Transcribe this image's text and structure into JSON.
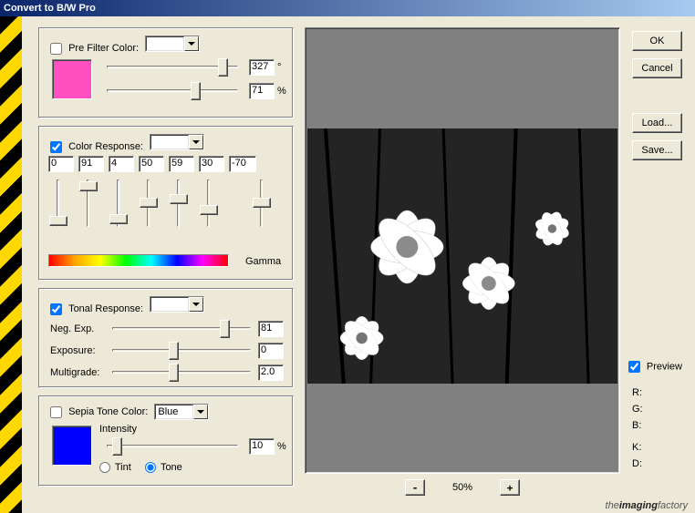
{
  "title": "Convert to B/W Pro",
  "buttons": {
    "ok": "OK",
    "cancel": "Cancel",
    "load": "Load...",
    "save": "Save..."
  },
  "preFilter": {
    "label": "Pre Filter Color:",
    "checked": false,
    "swatch": "#ff4fc0",
    "hue": {
      "value": "327",
      "unit": "°"
    },
    "sat": {
      "value": "71",
      "unit": "%"
    }
  },
  "colorResponse": {
    "label": "Color Response:",
    "checked": true,
    "values": [
      "0",
      "91",
      "4",
      "50",
      "59",
      "30",
      "-70"
    ],
    "gammaLabel": "Gamma"
  },
  "tonalResponse": {
    "label": "Tonal Response:",
    "checked": true,
    "negExp": {
      "label": "Neg. Exp.",
      "value": "81"
    },
    "exposure": {
      "label": "Exposure:",
      "value": "0"
    },
    "multigrade": {
      "label": "Multigrade:",
      "value": "2.0"
    }
  },
  "sepia": {
    "label": "Sepia Tone Color:",
    "checked": false,
    "selected": "Blue",
    "swatch": "#0000ff",
    "intensityLabel": "Intensity",
    "intensity": {
      "value": "10",
      "unit": "%"
    },
    "tintLabel": "Tint",
    "toneLabel": "Tone"
  },
  "preview": {
    "label": "Preview",
    "checked": true,
    "zoom": "50%",
    "readouts": {
      "r": "R:",
      "g": "G:",
      "b": "B:",
      "k": "K:",
      "d": "D:"
    }
  },
  "brand": {
    "the": "the",
    "imaging": "imaging",
    "factory": "factory"
  }
}
